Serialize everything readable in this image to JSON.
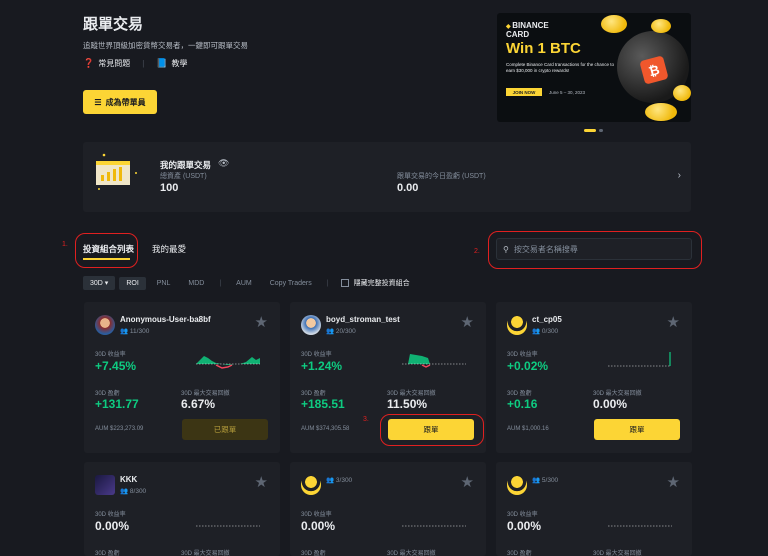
{
  "header": {
    "title": "跟單交易",
    "subtitle": "追蹤世界頂級加密貨幣交易者，一鍵即可跟單交易",
    "faq_label": "常見問題",
    "tutorial_label": "教學",
    "become_leader_label": "成為帶單員"
  },
  "banner": {
    "brand_top": "BINANCE",
    "brand_bottom": "CARD",
    "headline": "Win 1 BTC",
    "description": "Complete Binance Card transactions for the chance to earn $30,000 in crypto rewards!",
    "join_label": "JOIN NOW",
    "date": "June 5 – 30, 2023",
    "btc_glyph": "₿"
  },
  "my_copy_trading": {
    "title": "我的跟單交易",
    "total_assets_label": "總資產 (USDT)",
    "total_assets_value": "100",
    "today_pnl_label": "跟單交易的今日盈虧 (USDT)",
    "today_pnl_value": "0.00"
  },
  "tabs": {
    "portfolio_list": "投資組合列表",
    "favorites": "我的最愛"
  },
  "annotations": {
    "a1": "1.",
    "a2": "2.",
    "a3": "3."
  },
  "search": {
    "placeholder": "按交易者名稱搜尋"
  },
  "filters": {
    "period": "30D ▾",
    "roi": "ROI",
    "pnl": "PNL",
    "mdd": "MDD",
    "aum": "AUM",
    "copy_traders": "Copy Traders",
    "hide_full": "隱藏完整投資組合"
  },
  "card_labels": {
    "roi_label": "30D 收益率",
    "pnl_label": "30D 盈虧",
    "mdd_label": "30D 最大交易回撤",
    "copy_label": "跟單",
    "copied_label": "已跟單"
  },
  "traders": [
    {
      "name": "Anonymous-User-ba8bf",
      "count": "11/300",
      "roi": "+7.45%",
      "pnl": "+131.77",
      "mdd": "6.67%",
      "aum": "AUM $223,273.09"
    },
    {
      "name": "boyd_stroman_test",
      "count": "20/300",
      "roi": "+1.24%",
      "pnl": "+185.51",
      "mdd": "11.50%",
      "aum": "AUM $374,305.58"
    },
    {
      "name": "ct_cp05",
      "count": "0/300",
      "roi": "+0.02%",
      "pnl": "+0.16",
      "mdd": "0.00%",
      "aum": "AUM $1,000.16"
    },
    {
      "name": "KKK",
      "count": "8/300",
      "roi": "0.00%"
    },
    {
      "name": "",
      "count": "3/300",
      "roi": "0.00%"
    },
    {
      "name": "",
      "count": "5/300",
      "roi": "0.00%"
    }
  ],
  "colors": {
    "accent": "#fcd535",
    "positive": "#0ecb81",
    "negative": "#f6465d",
    "annotation": "#e02020"
  }
}
